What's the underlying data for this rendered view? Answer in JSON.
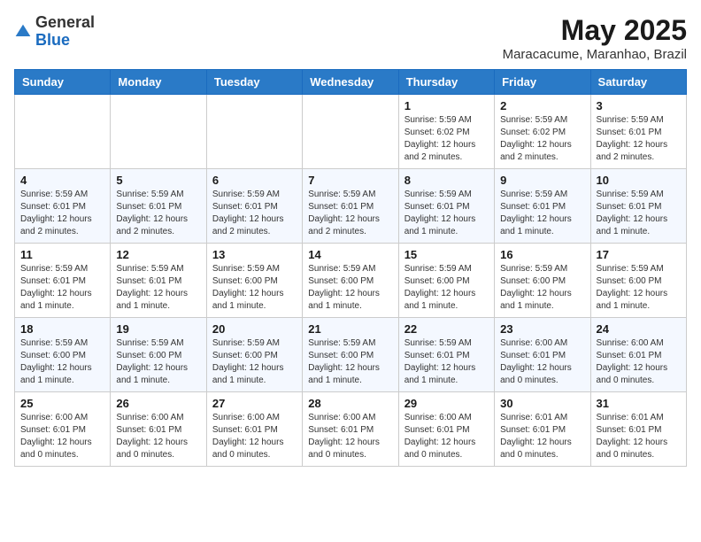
{
  "header": {
    "logo_general": "General",
    "logo_blue": "Blue",
    "month_title": "May 2025",
    "location": "Maracacume, Maranhao, Brazil"
  },
  "weekdays": [
    "Sunday",
    "Monday",
    "Tuesday",
    "Wednesday",
    "Thursday",
    "Friday",
    "Saturday"
  ],
  "weeks": [
    [
      {
        "day": "",
        "info": ""
      },
      {
        "day": "",
        "info": ""
      },
      {
        "day": "",
        "info": ""
      },
      {
        "day": "",
        "info": ""
      },
      {
        "day": "1",
        "info": "Sunrise: 5:59 AM\nSunset: 6:02 PM\nDaylight: 12 hours\nand 2 minutes."
      },
      {
        "day": "2",
        "info": "Sunrise: 5:59 AM\nSunset: 6:02 PM\nDaylight: 12 hours\nand 2 minutes."
      },
      {
        "day": "3",
        "info": "Sunrise: 5:59 AM\nSunset: 6:01 PM\nDaylight: 12 hours\nand 2 minutes."
      }
    ],
    [
      {
        "day": "4",
        "info": "Sunrise: 5:59 AM\nSunset: 6:01 PM\nDaylight: 12 hours\nand 2 minutes."
      },
      {
        "day": "5",
        "info": "Sunrise: 5:59 AM\nSunset: 6:01 PM\nDaylight: 12 hours\nand 2 minutes."
      },
      {
        "day": "6",
        "info": "Sunrise: 5:59 AM\nSunset: 6:01 PM\nDaylight: 12 hours\nand 2 minutes."
      },
      {
        "day": "7",
        "info": "Sunrise: 5:59 AM\nSunset: 6:01 PM\nDaylight: 12 hours\nand 2 minutes."
      },
      {
        "day": "8",
        "info": "Sunrise: 5:59 AM\nSunset: 6:01 PM\nDaylight: 12 hours\nand 1 minute."
      },
      {
        "day": "9",
        "info": "Sunrise: 5:59 AM\nSunset: 6:01 PM\nDaylight: 12 hours\nand 1 minute."
      },
      {
        "day": "10",
        "info": "Sunrise: 5:59 AM\nSunset: 6:01 PM\nDaylight: 12 hours\nand 1 minute."
      }
    ],
    [
      {
        "day": "11",
        "info": "Sunrise: 5:59 AM\nSunset: 6:01 PM\nDaylight: 12 hours\nand 1 minute."
      },
      {
        "day": "12",
        "info": "Sunrise: 5:59 AM\nSunset: 6:01 PM\nDaylight: 12 hours\nand 1 minute."
      },
      {
        "day": "13",
        "info": "Sunrise: 5:59 AM\nSunset: 6:00 PM\nDaylight: 12 hours\nand 1 minute."
      },
      {
        "day": "14",
        "info": "Sunrise: 5:59 AM\nSunset: 6:00 PM\nDaylight: 12 hours\nand 1 minute."
      },
      {
        "day": "15",
        "info": "Sunrise: 5:59 AM\nSunset: 6:00 PM\nDaylight: 12 hours\nand 1 minute."
      },
      {
        "day": "16",
        "info": "Sunrise: 5:59 AM\nSunset: 6:00 PM\nDaylight: 12 hours\nand 1 minute."
      },
      {
        "day": "17",
        "info": "Sunrise: 5:59 AM\nSunset: 6:00 PM\nDaylight: 12 hours\nand 1 minute."
      }
    ],
    [
      {
        "day": "18",
        "info": "Sunrise: 5:59 AM\nSunset: 6:00 PM\nDaylight: 12 hours\nand 1 minute."
      },
      {
        "day": "19",
        "info": "Sunrise: 5:59 AM\nSunset: 6:00 PM\nDaylight: 12 hours\nand 1 minute."
      },
      {
        "day": "20",
        "info": "Sunrise: 5:59 AM\nSunset: 6:00 PM\nDaylight: 12 hours\nand 1 minute."
      },
      {
        "day": "21",
        "info": "Sunrise: 5:59 AM\nSunset: 6:00 PM\nDaylight: 12 hours\nand 1 minute."
      },
      {
        "day": "22",
        "info": "Sunrise: 5:59 AM\nSunset: 6:01 PM\nDaylight: 12 hours\nand 1 minute."
      },
      {
        "day": "23",
        "info": "Sunrise: 6:00 AM\nSunset: 6:01 PM\nDaylight: 12 hours\nand 0 minutes."
      },
      {
        "day": "24",
        "info": "Sunrise: 6:00 AM\nSunset: 6:01 PM\nDaylight: 12 hours\nand 0 minutes."
      }
    ],
    [
      {
        "day": "25",
        "info": "Sunrise: 6:00 AM\nSunset: 6:01 PM\nDaylight: 12 hours\nand 0 minutes."
      },
      {
        "day": "26",
        "info": "Sunrise: 6:00 AM\nSunset: 6:01 PM\nDaylight: 12 hours\nand 0 minutes."
      },
      {
        "day": "27",
        "info": "Sunrise: 6:00 AM\nSunset: 6:01 PM\nDaylight: 12 hours\nand 0 minutes."
      },
      {
        "day": "28",
        "info": "Sunrise: 6:00 AM\nSunset: 6:01 PM\nDaylight: 12 hours\nand 0 minutes."
      },
      {
        "day": "29",
        "info": "Sunrise: 6:00 AM\nSunset: 6:01 PM\nDaylight: 12 hours\nand 0 minutes."
      },
      {
        "day": "30",
        "info": "Sunrise: 6:01 AM\nSunset: 6:01 PM\nDaylight: 12 hours\nand 0 minutes."
      },
      {
        "day": "31",
        "info": "Sunrise: 6:01 AM\nSunset: 6:01 PM\nDaylight: 12 hours\nand 0 minutes."
      }
    ]
  ]
}
